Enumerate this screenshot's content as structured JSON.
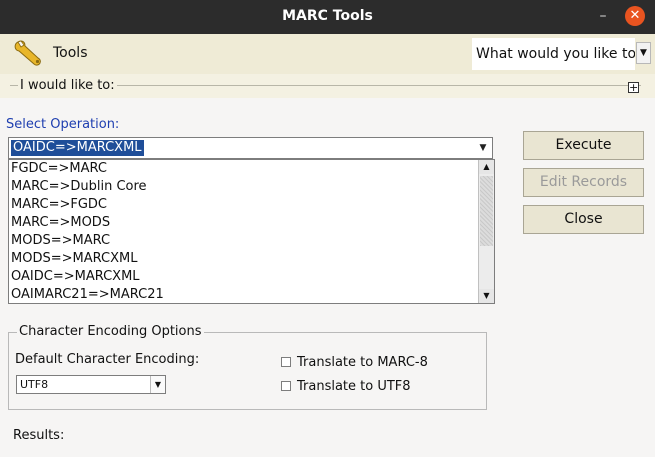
{
  "window": {
    "title": "MARC Tools",
    "minimize_glyph": "–",
    "close_glyph": "✕"
  },
  "toolbar": {
    "tools_label": "Tools",
    "what_label": "What would you like to",
    "what_arrow": "▼"
  },
  "strip": {
    "label": "I would like to:",
    "expand_glyph": "+"
  },
  "operation": {
    "label": "Select Operation:",
    "selected": "OAIDC=>MARCXML",
    "arrow": "▼",
    "options": [
      "FGDC=>MARC",
      "MARC=>Dublin Core",
      "MARC=>FGDC",
      "MARC=>MODS",
      "MODS=>MARC",
      "MODS=>MARCXML",
      "OAIDC=>MARCXML",
      "OAIMARC21=>MARC21"
    ],
    "scroll_up": "▲",
    "scroll_down": "▼"
  },
  "buttons": {
    "execute": "Execute",
    "edit_records": "Edit Records",
    "close": "Close"
  },
  "encoding": {
    "legend": "Character Encoding Options",
    "default_label": "Default Character Encoding:",
    "default_value": "UTF8",
    "arrow": "▼",
    "translate_marc8": "Translate to MARC-8",
    "translate_utf8": "Translate to UTF8"
  },
  "results_label": "Results:",
  "colors": {
    "accent": "#1f4e99",
    "label_blue": "#1f3fb0",
    "titlebar": "#2c2c2c",
    "close": "#e95420"
  }
}
